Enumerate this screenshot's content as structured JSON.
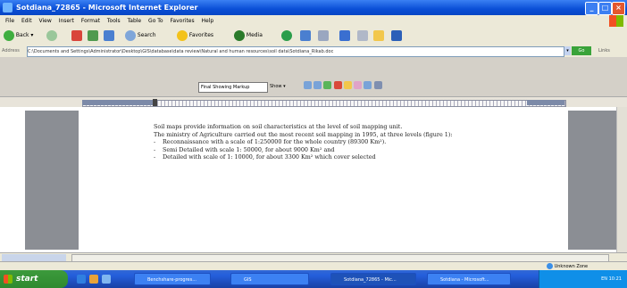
{
  "window": {
    "title": "Sotdiana_72865 - Microsoft Internet Explorer",
    "controls": [
      "_",
      "□",
      "×"
    ]
  },
  "menu": [
    "File",
    "Edit",
    "View",
    "Insert",
    "Format",
    "Tools",
    "Table",
    "Go To",
    "Favorites",
    "Help"
  ],
  "toolbar": {
    "back": "Back",
    "search": "Search",
    "favorites": "Favorites",
    "media": "Media"
  },
  "address": {
    "label": "Address",
    "value": "C:\\Documents and Settings\\Administrator\\Desktop\\GIS\\database\\data review\\Natural and human resources\\soil data\\Sotdiana_Rikab.doc",
    "go": "Go",
    "links": "Links"
  },
  "word": {
    "markup": "Final Showing Markup",
    "show": "Show"
  },
  "document": {
    "paragraphs": [
      "Soil maps provide information on soil characteristics at the level of soil mapping unit.",
      "The ministry of Agriculture carried out the most recent soil mapping in 1995, at three levels (figure 1):"
    ],
    "bullets": [
      "Reconnaissance with a scale of 1:250000 for the whole country (89300 Km²).",
      "Semi Detailed with scale 1: 50000, for about 9000 Km²  and",
      "Detailed with scale of 1: 10000, for about 3300 Km² which cover selected"
    ]
  },
  "status": {
    "zone": "Unknown Zone"
  },
  "taskbar": {
    "start": "start",
    "tasks": [
      "Benchshare-progres...",
      "GIS",
      "Sotdiana_72865 - Mic...",
      "Sotdiana - Microsoft..."
    ],
    "clock": "EN  10:21"
  }
}
